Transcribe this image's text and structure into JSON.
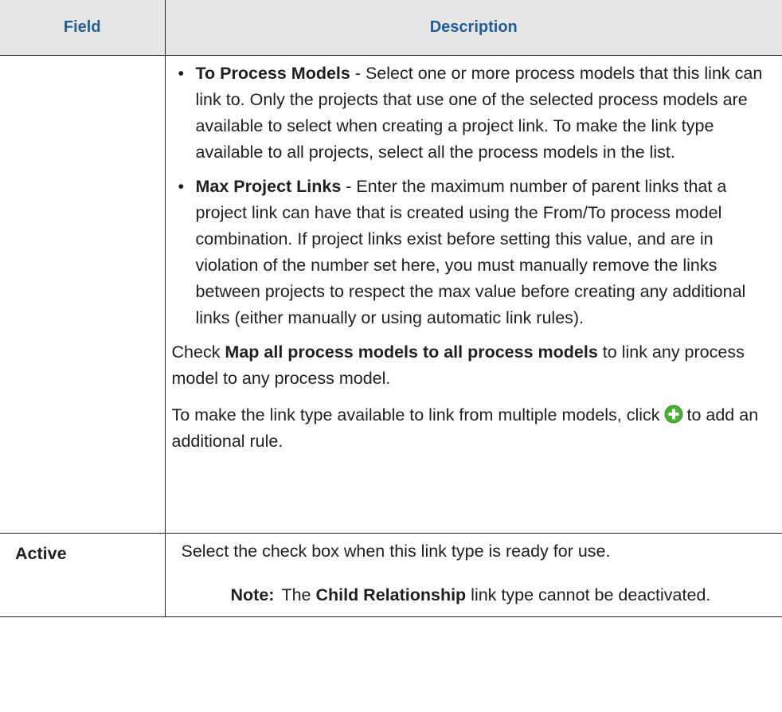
{
  "table": {
    "headers": {
      "field": "Field",
      "description": "Description"
    },
    "row1": {
      "field": "",
      "bullets": [
        {
          "term": "To Process Models",
          "text": " - Select one or more process models that this link can link to. Only the projects that use one of the selected process models are available to select when creating a project link. To make the link type available to all projects, select all the process models in the list."
        },
        {
          "term": "Max Project Links",
          "text": " - Enter the maximum number of parent links that a project link can have that is created using the From/To process model combination. If project links exist before setting this value, and are in violation of the number set here, you must manually remove the links between projects to respect the max value before creating any additional links (either manually or using automatic link rules)."
        }
      ],
      "check_prefix": "Check ",
      "check_term": "Map all process models to all process models",
      "check_suffix": " to link any process model to any process model.",
      "multi_text_1": "To make the link type available to link from multiple models, click ",
      "multi_text_2": "to add an additional rule."
    },
    "row2": {
      "field": "Active",
      "description": "Select the check box when this link type is ready for use.",
      "note_label": "Note:",
      "note_prefix": "The ",
      "note_term": "Child Relationship",
      "note_suffix": " link type cannot be deactivated."
    }
  },
  "colors": {
    "header_bg": "#e6e6e6",
    "header_text": "#1f5e96",
    "add_icon": "#4caf35"
  },
  "icons": {
    "add_rule": "plus-circle-icon",
    "bullet": "bullet-dot"
  }
}
